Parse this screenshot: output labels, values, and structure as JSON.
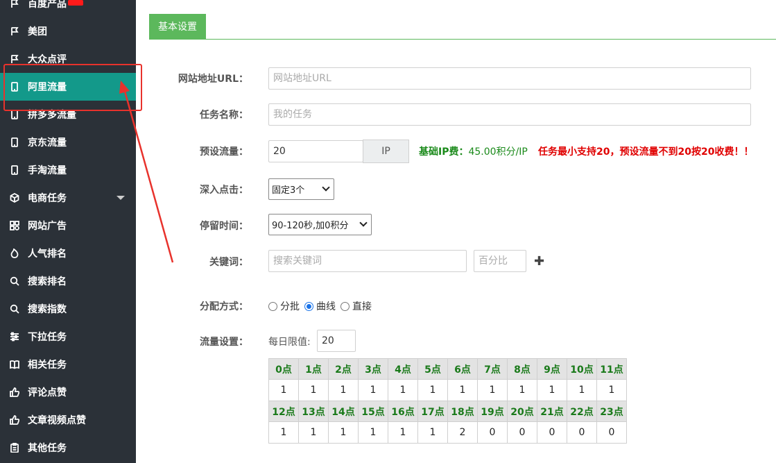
{
  "sidebar": {
    "items": [
      {
        "label": "百度产品",
        "icon": "flag-icon"
      },
      {
        "label": "美团",
        "icon": "flag-icon"
      },
      {
        "label": "大众点评",
        "icon": "flag-icon"
      },
      {
        "label": "阿里流量",
        "icon": "tablet-icon",
        "active": true
      },
      {
        "label": "拼多多流量",
        "icon": "tablet-icon"
      },
      {
        "label": "京东流量",
        "icon": "tablet-icon"
      },
      {
        "label": "手淘流量",
        "icon": "tablet-icon"
      },
      {
        "label": "电商任务",
        "icon": "cube-icon",
        "has_submenu": true
      },
      {
        "label": "网站广告",
        "icon": "apps-icon"
      },
      {
        "label": "人气排名",
        "icon": "fire-icon"
      },
      {
        "label": "搜索排名",
        "icon": "search-icon"
      },
      {
        "label": "搜索指数",
        "icon": "search-icon"
      },
      {
        "label": "下拉任务",
        "icon": "sliders-icon"
      },
      {
        "label": "相关任务",
        "icon": "book-icon"
      },
      {
        "label": "评论点赞",
        "icon": "thumbs-up-icon"
      },
      {
        "label": "文章视频点赞",
        "icon": "thumbs-up-icon"
      },
      {
        "label": "其他任务",
        "icon": "clipboard-icon"
      }
    ]
  },
  "tabs": {
    "basic_settings": "基本设置"
  },
  "form": {
    "url": {
      "label": "网站地址URL：",
      "placeholder": "网站地址URL",
      "value": ""
    },
    "task_name": {
      "label": "任务名称：",
      "placeholder": "我的任务",
      "value": ""
    },
    "traffic": {
      "label": "预设流量：",
      "value": "20",
      "addon": "IP"
    },
    "fee": {
      "label": "基础IP费：",
      "value": "45.00积分/IP",
      "warning": "任务最小支持20，预设流量不到20按20收费！！"
    },
    "depth_click": {
      "label": "深入点击：",
      "selected": "固定3个"
    },
    "stay_time": {
      "label": "停留时间：",
      "selected": "90-120秒,加0积分"
    },
    "keywords": {
      "label": "关键词：",
      "placeholder": "搜索关键词",
      "percent_placeholder": "百分比",
      "add_symbol": "✚"
    },
    "distribution": {
      "label": "分配方式：",
      "options": [
        "分批",
        "曲线",
        "直接"
      ],
      "selected": "曲线"
    },
    "traffic_setting": {
      "label": "流量设置：",
      "daily_limit_label": "每日限值:",
      "daily_limit_value": "20"
    }
  },
  "hours_table": {
    "row1_headers": [
      "0点",
      "1点",
      "2点",
      "3点",
      "4点",
      "5点",
      "6点",
      "7点",
      "8点",
      "9点",
      "10点",
      "11点"
    ],
    "row1_values": [
      "1",
      "1",
      "1",
      "1",
      "1",
      "1",
      "1",
      "1",
      "1",
      "1",
      "1",
      "1"
    ],
    "row2_headers": [
      "12点",
      "13点",
      "14点",
      "15点",
      "16点",
      "17点",
      "18点",
      "19点",
      "20点",
      "21点",
      "22点",
      "23点"
    ],
    "row2_values": [
      "1",
      "1",
      "1",
      "1",
      "1",
      "1",
      "2",
      "0",
      "0",
      "0",
      "0",
      "0"
    ]
  },
  "colors": {
    "sidebar_bg": "#2b3138",
    "active_item": "#13998a",
    "tab_green": "#5cb85c",
    "annotation_red": "#e8322c",
    "fee_green": "#1a8a1a",
    "warning_red": "#e00000"
  }
}
